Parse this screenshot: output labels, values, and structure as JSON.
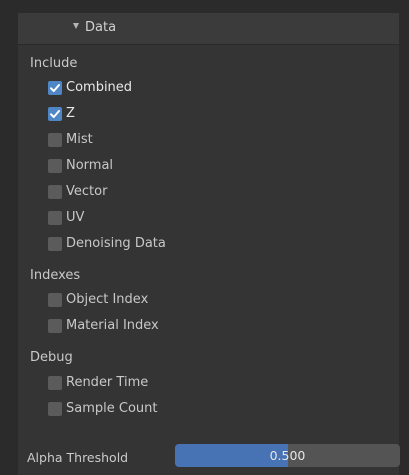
{
  "panel": {
    "title": "Data",
    "sections": [
      {
        "label": "Include",
        "items": [
          {
            "label": "Combined",
            "checked": true
          },
          {
            "label": "Z",
            "checked": true
          },
          {
            "label": "Mist",
            "checked": false
          },
          {
            "label": "Normal",
            "checked": false
          },
          {
            "label": "Vector",
            "checked": false
          },
          {
            "label": "UV",
            "checked": false
          },
          {
            "label": "Denoising Data",
            "checked": false
          }
        ]
      },
      {
        "label": "Indexes",
        "items": [
          {
            "label": "Object Index",
            "checked": false
          },
          {
            "label": "Material Index",
            "checked": false
          }
        ]
      },
      {
        "label": "Debug",
        "items": [
          {
            "label": "Render Time",
            "checked": false
          },
          {
            "label": "Sample Count",
            "checked": false
          }
        ]
      }
    ],
    "alpha_threshold": {
      "label": "Alpha Threshold",
      "value": "0.500",
      "fraction": 0.5
    }
  },
  "colors": {
    "checked_box": "#4f86c6",
    "slider_fill": "#4772b3"
  }
}
